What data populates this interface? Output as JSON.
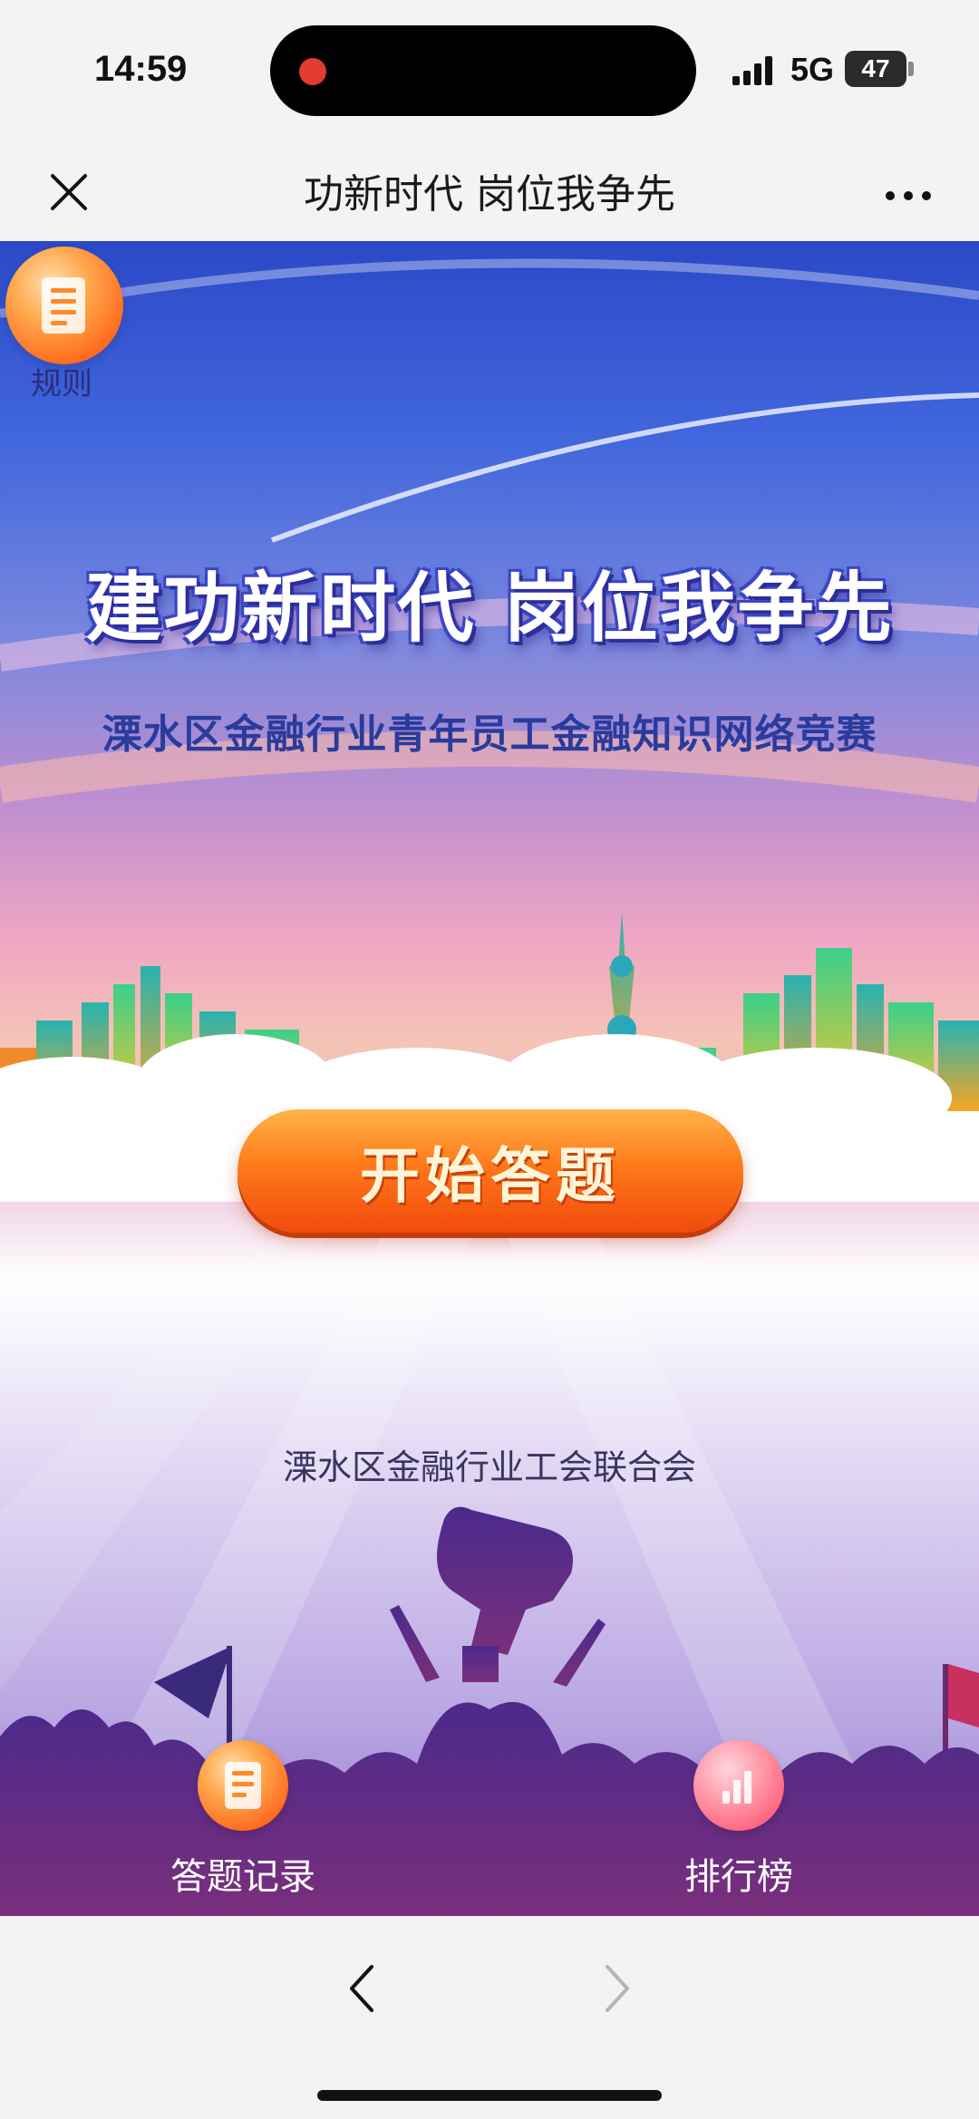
{
  "status_bar": {
    "time": "14:59",
    "network": "5G",
    "battery": "47"
  },
  "nav": {
    "title": "功新时代 岗位我争先",
    "close_icon": "close-icon",
    "more_icon": "more-icon"
  },
  "hero": {
    "rules_label": "规则",
    "headline": "建功新时代 岗位我争先",
    "subtitle": "溧水区金融行业青年员工金融知识网络竞赛",
    "start_button": "开始答题",
    "organizer": "溧水区金融行业工会联合会"
  },
  "bottom_actions": {
    "record_label": "答题记录",
    "rank_label": "排行榜"
  },
  "browser": {
    "back_icon": "chevron-left-icon",
    "forward_icon": "chevron-right-icon"
  },
  "colors": {
    "accent_orange": "#ff7a1a",
    "title_blue": "#2a3b9c",
    "sky_blue": "#2b49c8"
  }
}
